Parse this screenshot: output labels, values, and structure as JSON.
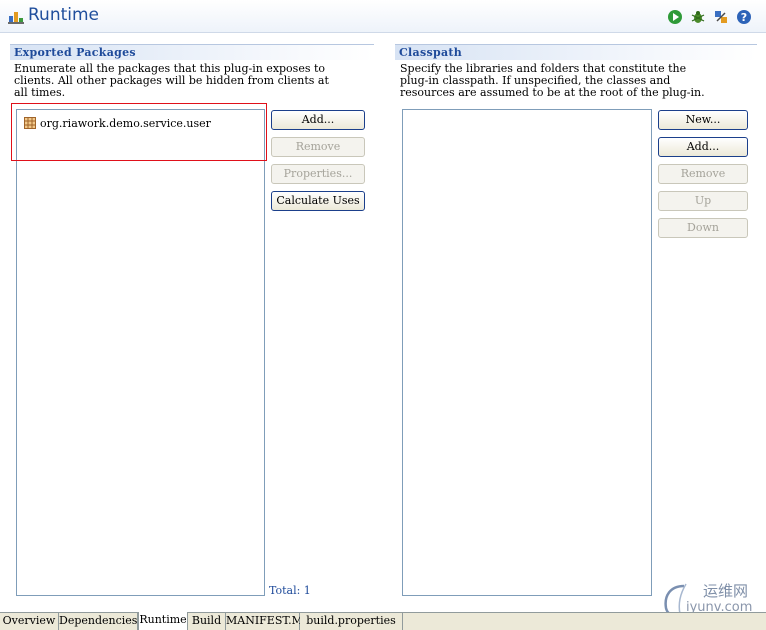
{
  "header": {
    "title": "Runtime"
  },
  "exported": {
    "heading": "Exported Packages",
    "description": [
      "Enumerate all the packages that this plug-in exposes to",
      "clients.  All other packages will be hidden from clients at",
      "all times."
    ],
    "packages": [
      "org.riawork.demo.service.user"
    ],
    "buttons": {
      "add": "Add...",
      "remove": "Remove",
      "properties": "Properties...",
      "calculate": "Calculate Uses"
    },
    "total": "Total: 1"
  },
  "classpath": {
    "heading": "Classpath",
    "description": [
      "Specify the libraries and folders that constitute the",
      "plug-in classpath.  If unspecified, the classes and",
      "resources are assumed to be at the root of the plug-in."
    ],
    "buttons": {
      "new": "New...",
      "add": "Add...",
      "remove": "Remove",
      "up": "Up",
      "down": "Down"
    }
  },
  "tabs": [
    "Overview",
    "Dependencies",
    "Runtime",
    "Build",
    "MANIFEST.MF",
    "build.properties"
  ],
  "active_tab": "Runtime",
  "icons": [
    "runtime-icon",
    "run-icon",
    "debug-icon",
    "export-icon",
    "help-icon",
    "package-icon"
  ],
  "watermark": {
    "cn": "运维网",
    "en": "iyunv.com"
  },
  "colors": {
    "section_title": "#1e4a9a",
    "highlight_box": "#e0101a",
    "title": "#1f4e9c"
  }
}
